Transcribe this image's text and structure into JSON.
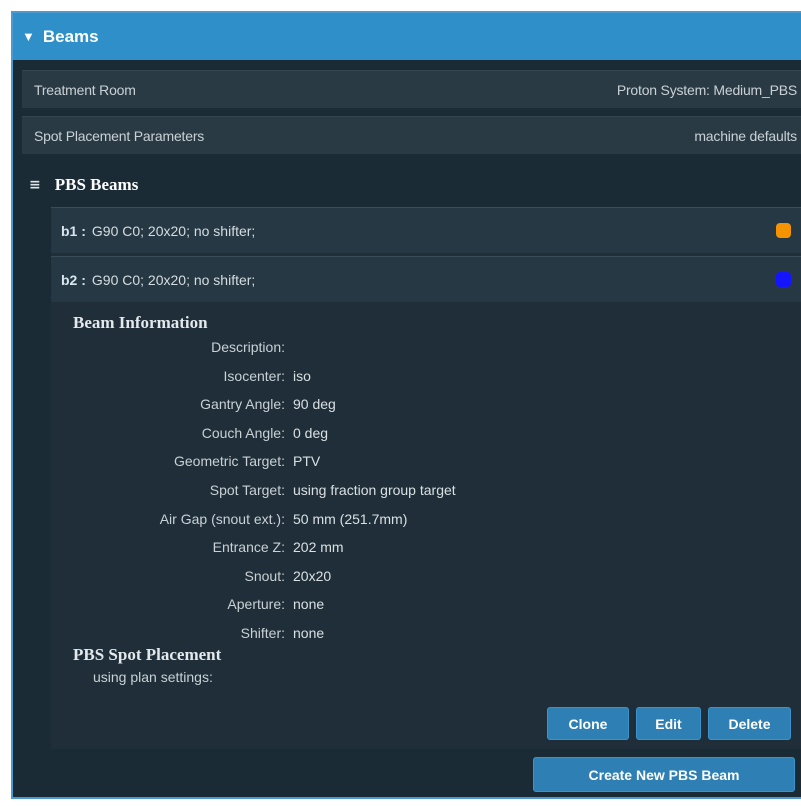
{
  "header": {
    "title": "Beams",
    "toggle_glyph": "▼"
  },
  "rows": [
    {
      "label": "Treatment Room",
      "value": "Proton System: Medium_PBS"
    },
    {
      "label": "Spot Placement Parameters",
      "value": "machine defaults"
    }
  ],
  "pbs_section": {
    "title": "PBS Beams",
    "menu_glyph": "≡"
  },
  "beams": [
    {
      "id": "b1 :",
      "summary": "G90 C0; 20x20; no shifter;",
      "color": "#f59300"
    },
    {
      "id": "b2 :",
      "summary": "G90 C0; 20x20; no shifter;",
      "color": "#1414ff"
    }
  ],
  "beam_info": {
    "heading": "Beam Information",
    "fields": [
      {
        "label": "Description:",
        "value": ""
      },
      {
        "label": "Isocenter:",
        "value": "iso"
      },
      {
        "label": "Gantry Angle:",
        "value": "90 deg"
      },
      {
        "label": "Couch Angle:",
        "value": "0 deg"
      },
      {
        "label": "Geometric Target:",
        "value": "PTV"
      },
      {
        "label": "Spot Target:",
        "value": "using fraction group target"
      },
      {
        "label": "Air Gap (snout ext.):",
        "value": "50 mm (251.7mm)"
      },
      {
        "label": "Entrance Z:",
        "value": "202 mm"
      },
      {
        "label": "Snout:",
        "value": "20x20"
      },
      {
        "label": "Aperture:",
        "value": "none"
      },
      {
        "label": "Shifter:",
        "value": "none"
      }
    ]
  },
  "spot_placement": {
    "heading": "PBS Spot Placement",
    "line": "using plan settings:"
  },
  "buttons": {
    "clone": "Clone",
    "edit": "Edit",
    "delete": "Delete",
    "create": "Create New PBS Beam"
  }
}
